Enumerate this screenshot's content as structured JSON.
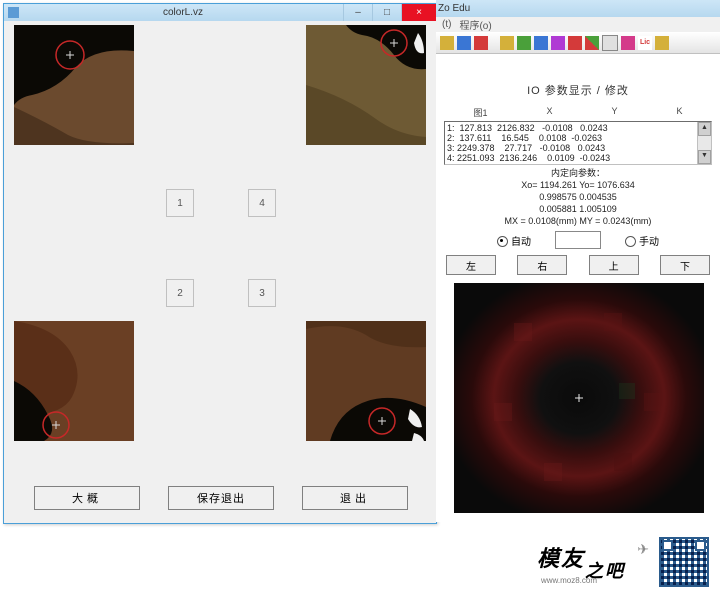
{
  "left_window": {
    "title": "colorL.vz",
    "icon": "app-icon",
    "win_controls": {
      "min": "–",
      "max": "□",
      "close": "×"
    },
    "quadrant_buttons": [
      "1",
      "4",
      "2",
      "3"
    ],
    "bottom_buttons": {
      "yes": "大概",
      "save_exit": "保存退出",
      "exit": "退出"
    }
  },
  "right_window": {
    "title": "Zo Edu",
    "menu": {
      "item1": "(t)",
      "item2": "程序(o)"
    },
    "panel_title": "IO 参数显示 / 修改",
    "headers": {
      "c1": "图1",
      "c2": "X",
      "c3": "Y",
      "c4": "K"
    },
    "rows": [
      "1:  127.813  2126.832   -0.0108   0.0243",
      "2:  137.611    16.545    0.0108  -0.0263",
      "3: 2249.378    27.717   -0.0108   0.0243",
      "4: 2251.093  2136.246    0.0109  -0.0243"
    ],
    "info": {
      "l1": "内定向参数：",
      "l2": "Xo= 1194.261   Yo= 1076.634",
      "l3": "0.998575        0.004535",
      "l4": "0.005881        1.005109",
      "l5": "MX = 0.0108(mm)   MY = 0.0243(mm)"
    },
    "mode": {
      "auto": "自动",
      "manual": "手动"
    },
    "dir": {
      "left": "左",
      "right": "右",
      "up": "上",
      "down": "下"
    }
  },
  "footer": {
    "brand_a": "模友",
    "brand_b": "之吧",
    "url": "www.moz8.com",
    "plane": "✈"
  }
}
